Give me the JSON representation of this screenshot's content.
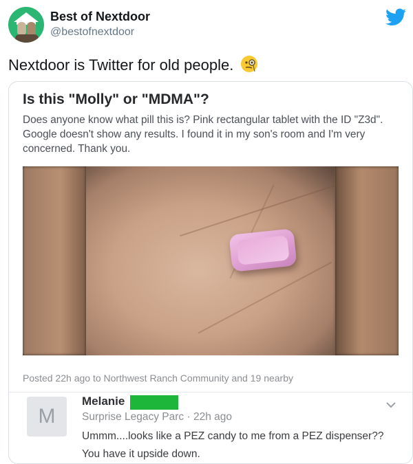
{
  "tweet": {
    "author_name": "Best of Nextdoor",
    "author_handle": "@bestofnextdoor",
    "text": "Nextdoor is Twitter for old people.",
    "emoji": "face-with-monocle-icon",
    "brand_icon": "twitter-bird-icon"
  },
  "post": {
    "title": "Is this \"Molly\" or \"MDMA\"?",
    "body": "Does anyone know what pill this is? Pink rectangular tablet with the ID \"Z3d\". Google doesn't show any results. I found it in my son's room and I'm very concerned. Thank you.",
    "meta": "Posted 22h ago to Northwest Ranch Community and 19 nearby"
  },
  "comment": {
    "avatar_letter": "M",
    "name": "Melanie",
    "location_time": "Surprise Legacy Parc · 22h ago",
    "text": "Ummm....looks like a PEZ candy to me from a PEZ dispenser?? You have it upside down."
  },
  "colors": {
    "twitter_blue": "#1da1f2",
    "redaction_green": "#1db53a",
    "avatar_green": "#2bb673"
  }
}
